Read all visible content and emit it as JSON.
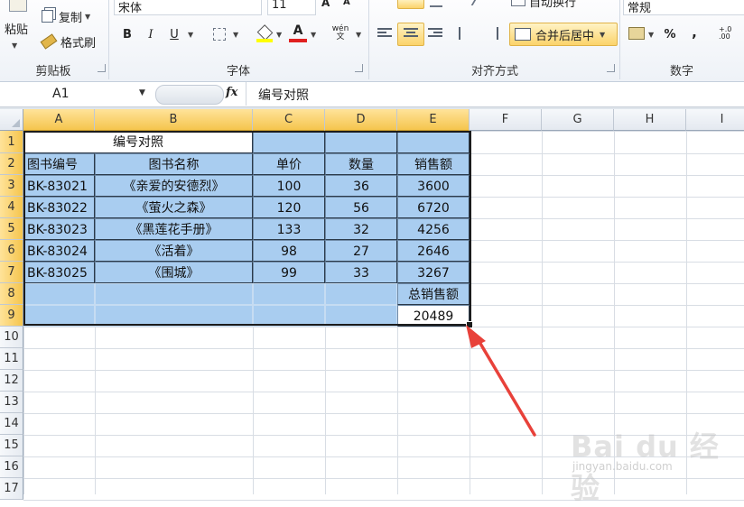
{
  "ribbon": {
    "clipboard": {
      "paste_label": "粘贴",
      "copy_label": "复制",
      "format_painter_label": "格式刷",
      "group_label": "剪贴板"
    },
    "font": {
      "font_name": "宋体",
      "font_size": "11",
      "bold": "B",
      "italic": "I",
      "underline": "U",
      "font_color_glyph": "A",
      "phonetic_glyph": "wén 文",
      "group_label": "字体"
    },
    "alignment": {
      "wrap_label": "自动换行",
      "merge_center_label": "合并后居中",
      "group_label": "对齐方式"
    },
    "number": {
      "format_value": "常规",
      "percent": "%",
      "comma": ",",
      "decimal": "+.0 .00",
      "group_label": "数字"
    }
  },
  "formula_bar": {
    "name_box": "A1",
    "fx": "fx",
    "content": "编号对照"
  },
  "columns": [
    "A",
    "B",
    "C",
    "D",
    "E",
    "F",
    "G",
    "H",
    "I"
  ],
  "rows": [
    "1",
    "2",
    "3",
    "4",
    "5",
    "6",
    "7",
    "8",
    "9",
    "10",
    "11",
    "12",
    "13",
    "14",
    "15",
    "16",
    "17"
  ],
  "sheet": {
    "title": "编号对照",
    "headers": [
      "图书编号",
      "图书名称",
      "单价",
      "数量",
      "销售额"
    ],
    "data": [
      [
        "BK-83021",
        "《亲爱的安德烈》",
        "100",
        "36",
        "3600"
      ],
      [
        "BK-83022",
        "《萤火之森》",
        "120",
        "56",
        "6720"
      ],
      [
        "BK-83023",
        "《黑莲花手册》",
        "133",
        "32",
        "4256"
      ],
      [
        "BK-83024",
        "《活着》",
        "98",
        "27",
        "2646"
      ],
      [
        "BK-83025",
        "《围城》",
        "99",
        "33",
        "3267"
      ]
    ],
    "total_label": "总销售额",
    "total_value": "20489"
  },
  "watermark": {
    "brand": "Bai du 经验",
    "url": "jingyan.baidu.com"
  },
  "colors": {
    "selection_fill": "#a9cdf0",
    "header_highlight": "#f5c54d",
    "arrow": "#e8413a"
  }
}
